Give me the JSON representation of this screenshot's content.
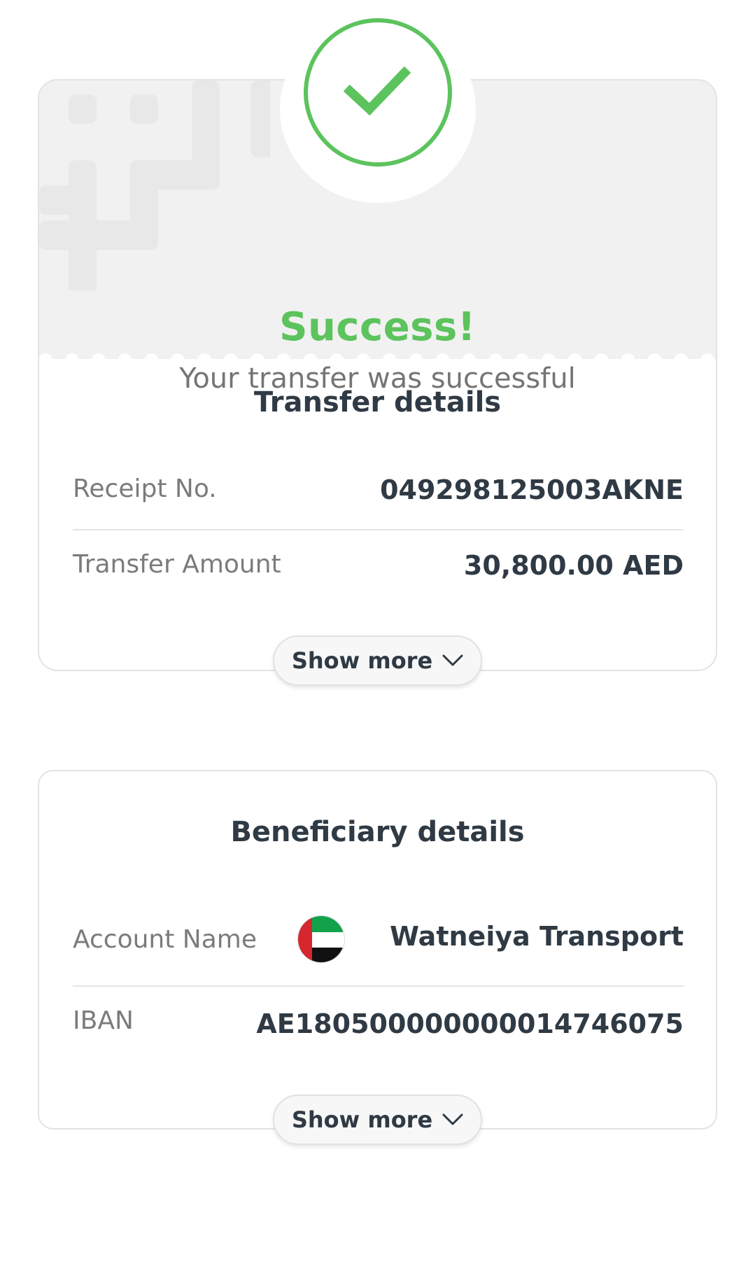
{
  "status": {
    "title": "Success!",
    "subtitle": "Your transfer was successful",
    "icon": "check-circle-icon",
    "color": "#5cc35d"
  },
  "transfer": {
    "title": "Transfer details",
    "rows": [
      {
        "label": "Receipt No.",
        "value": "049298125003AKNE"
      },
      {
        "label": "Transfer Amount",
        "value": "30,800.00 AED"
      }
    ],
    "show_more_label": "Show more"
  },
  "beneficiary": {
    "title": "Beneficiary details",
    "rows": [
      {
        "label": "Account Name",
        "value": "Watneiya Transport",
        "flag_icon": "uae-flag-icon"
      },
      {
        "label": "IBAN",
        "value": "AE180500000000014746075"
      }
    ],
    "show_more_label": "Show more"
  },
  "colors": {
    "accent": "#5cc35d",
    "text_dark": "#2f3a44",
    "text_muted": "#7b7b7b",
    "banner_bg": "#f1f1f1"
  }
}
